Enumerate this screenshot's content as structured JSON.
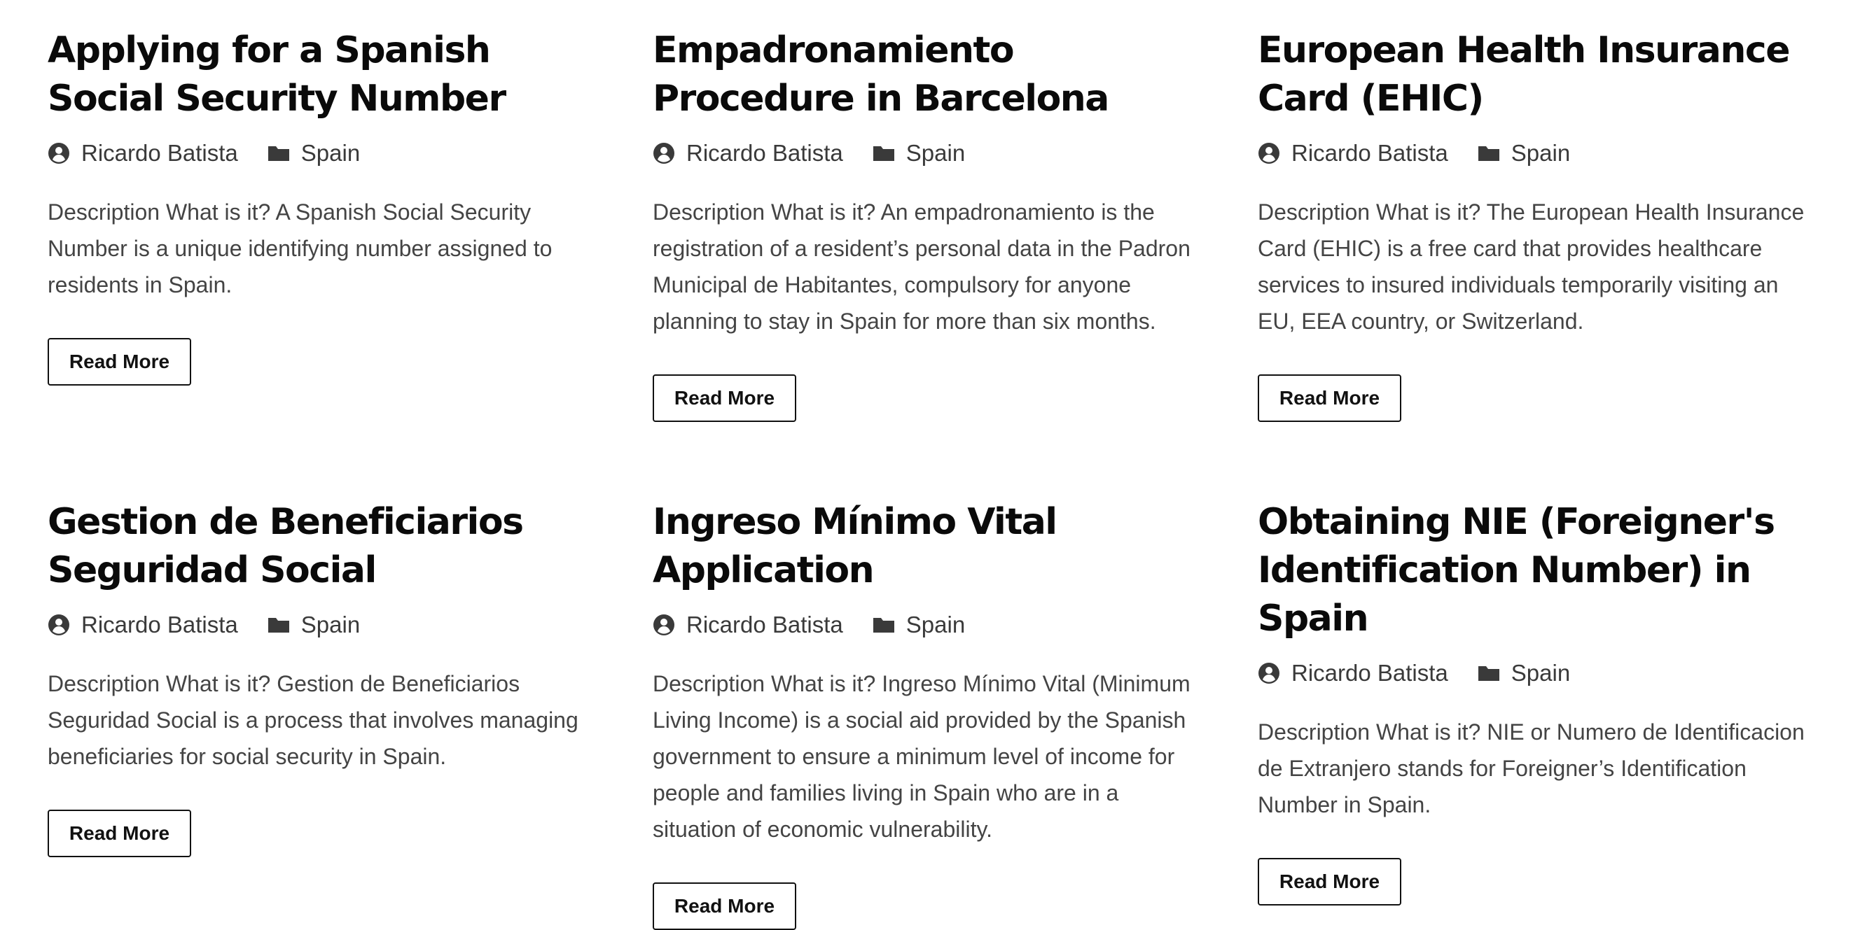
{
  "posts": [
    {
      "title": "Applying for a Spanish Social Security Number",
      "author": "Ricardo Batista",
      "category": "Spain",
      "description": "Description What is it? A Spanish Social Security Number is a unique identifying number assigned to residents in Spain.",
      "button_label": "Read More"
    },
    {
      "title": "Empadronamiento Procedure in Barcelona",
      "author": "Ricardo Batista",
      "category": "Spain",
      "description": "Description What is it? An empadronamiento is the registration of a resident’s personal data in the Padron Municipal de Habitantes, compulsory for anyone planning to stay in Spain for more than six months.",
      "button_label": "Read More"
    },
    {
      "title": "European Health Insurance Card (EHIC)",
      "author": "Ricardo Batista",
      "category": "Spain",
      "description": "Description What is it? The European Health Insurance Card (EHIC) is a free card that provides healthcare services to insured individuals temporarily visiting an EU, EEA country, or Switzerland.",
      "button_label": "Read More"
    },
    {
      "title": "Gestion de Beneficiarios Seguridad Social",
      "author": "Ricardo Batista",
      "category": "Spain",
      "description": "Description What is it? Gestion de Beneficiarios Seguridad Social is a process that involves managing beneficiaries for social security in Spain.",
      "button_label": "Read More"
    },
    {
      "title": "Ingreso Mínimo Vital Application",
      "author": "Ricardo Batista",
      "category": "Spain",
      "description": "Description What is it? Ingreso Mínimo Vital (Minimum Living Income) is a social aid provided by the Spanish government to ensure a minimum level of income for people and families living in Spain who are in a situation of economic vulnerability.",
      "button_label": "Read More"
    },
    {
      "title": "Obtaining NIE (Foreigner's Identification Number) in Spain",
      "author": "Ricardo Batista",
      "category": "Spain",
      "description": "Description What is it? NIE or Numero de Identificacion de Extranjero stands for Foreigner’s Identification Number in Spain.",
      "button_label": "Read More"
    }
  ],
  "icons": {
    "author": "user-circle-icon",
    "category": "folder-icon"
  },
  "colors": {
    "title": "#0a0a0a",
    "meta": "#3a3a3a",
    "description": "#444444",
    "button_border": "#111111"
  }
}
